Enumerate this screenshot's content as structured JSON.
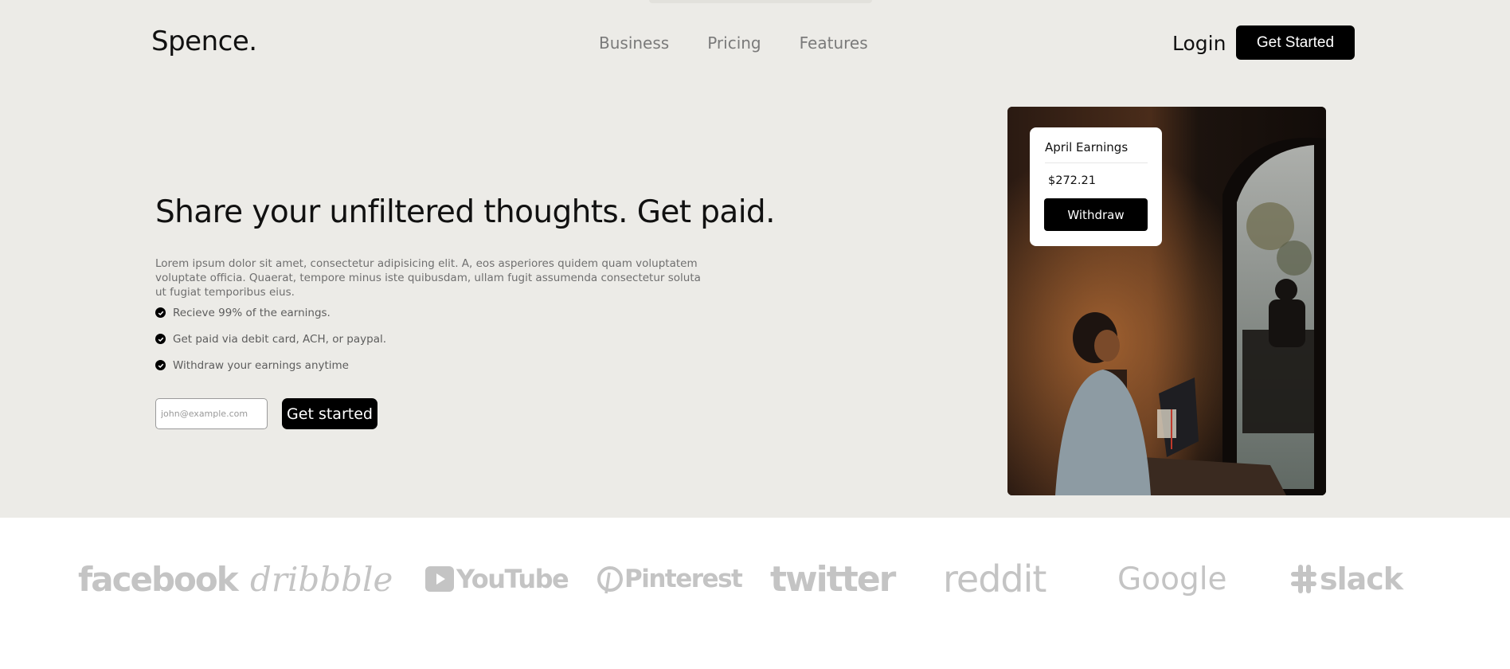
{
  "header": {
    "logo": "Spence.",
    "nav": [
      "Business",
      "Pricing",
      "Features"
    ],
    "login": "Login",
    "cta": "Get Started"
  },
  "hero": {
    "headline": "Share your unfiltered thoughts. Get paid.",
    "lead": "Lorem ipsum dolor sit amet, consectetur adipisicing elit. A, eos asperiores quidem quam voluptatem voluptate officia. Quaerat, tempore minus iste quibusdam, ullam fugit assumenda consectetur soluta ut fugiat temporibus eius.",
    "features": [
      "Recieve 99% of the earnings.",
      "Get paid via debit card, ACH, or paypal.",
      "Withdraw your earnings anytime"
    ],
    "email_placeholder": "john@example.com",
    "signup_button": "Get started"
  },
  "earnings_card": {
    "title": "April Earnings",
    "amount": "$272.21",
    "withdraw": "Withdraw"
  },
  "brands": [
    "facebook",
    "dribbble",
    "YouTube",
    "Pinterest",
    "twitter",
    "reddit",
    "Google",
    "slack"
  ],
  "colors": {
    "hero_bg": "#ecebe7",
    "accent": "#000000",
    "muted_text": "#7a7a7a",
    "brand_logo": "#c4c4c4"
  }
}
